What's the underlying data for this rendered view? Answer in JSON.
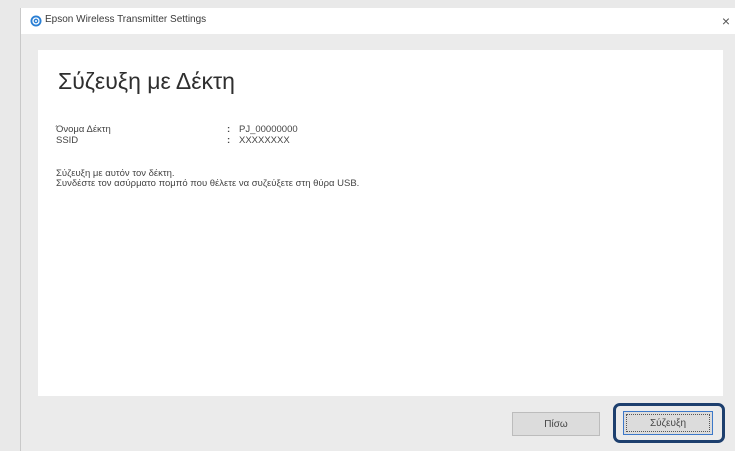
{
  "window": {
    "title": "Epson Wireless Transmitter Settings",
    "close_symbol": "×",
    "icon": "app-icon"
  },
  "main": {
    "heading": "Σύζευξη με Δέκτη",
    "fields": [
      {
        "label": "Όνομα Δέκτη",
        "colon": ":",
        "value": "PJ_00000000"
      },
      {
        "label": "SSID",
        "colon": ":",
        "value": "XXXXXXXX"
      }
    ],
    "message_lines": [
      "Σύζευξη με αυτόν τον δέκτη.",
      "Συνδέστε τον ασύρματο πομπό που θέλετε να συζεύξετε στη θύρα USB."
    ]
  },
  "buttons": {
    "back_label": "Πίσω",
    "pair_label": "Σύζευξη"
  },
  "colors": {
    "highlight_ring": "#1d3f6e",
    "window_bg": "#ebebeb",
    "panel_bg": "#ffffff"
  }
}
